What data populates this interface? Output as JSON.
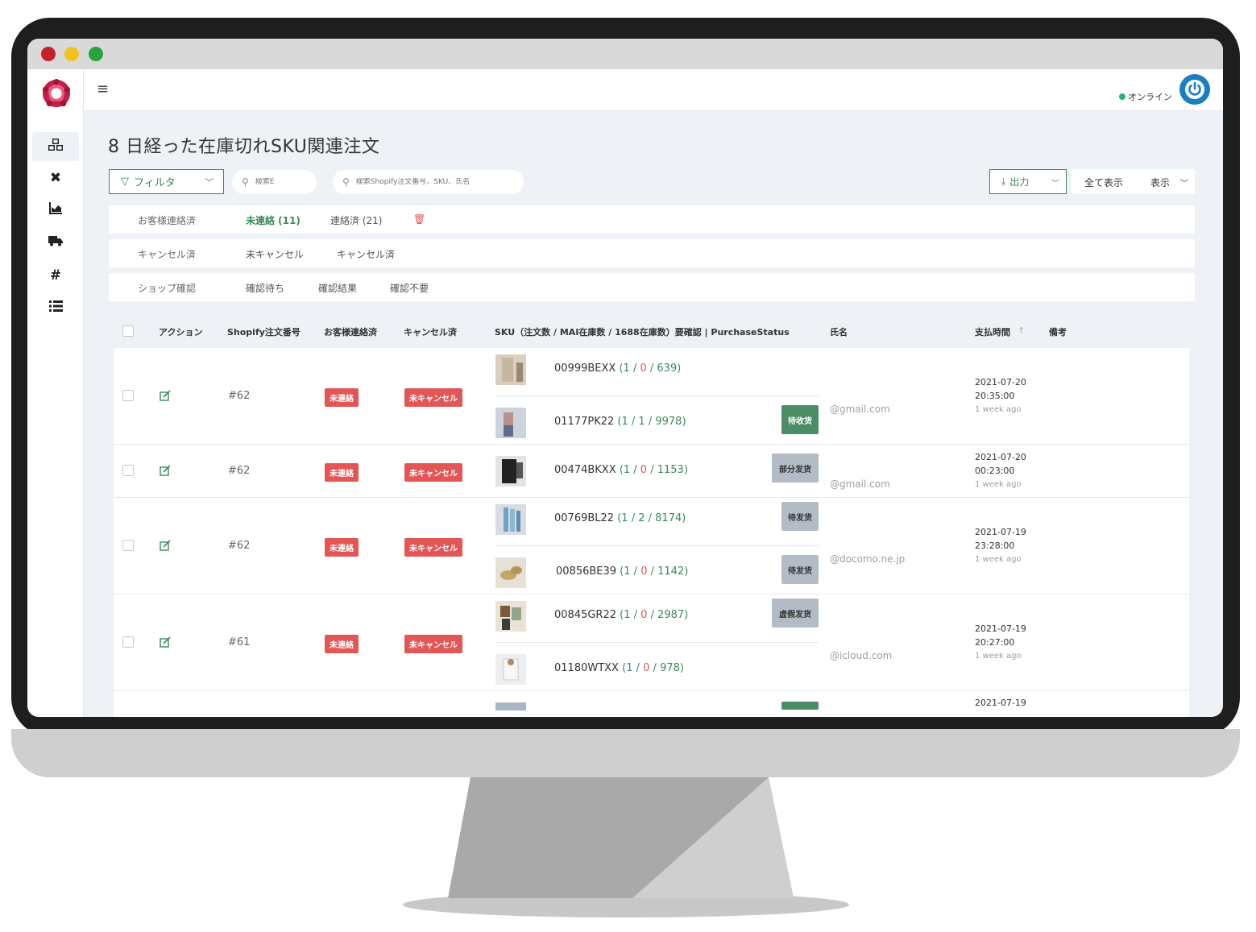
{
  "header": {
    "online_label": "オンライン"
  },
  "page": {
    "title": "8 日経った在庫切れSKU関連注文"
  },
  "toolbar": {
    "filter_label": "フィルタ",
    "search_small_placeholder": "検索E",
    "search_large_placeholder": "検索Shopify注文番号、SKU、氏名",
    "export_label": "出力",
    "show_all_label": "全て表示",
    "display_label": "表示"
  },
  "filters": {
    "contact": {
      "label": "お客様連絡済",
      "opt1": "未連絡 (11)",
      "opt2": "連絡済 (21)"
    },
    "cancel": {
      "label": "キャンセル済",
      "opt1": "未キャンセル",
      "opt2": "キャンセル済"
    },
    "shop": {
      "label": "ショップ確認",
      "opt1": "確認待ち",
      "opt2": "確認結果",
      "opt3": "確認不要"
    }
  },
  "table": {
    "headers": {
      "action": "アクション",
      "order_no": "Shopify注文番号",
      "contacted": "お客様連絡済",
      "cancelled": "キャンセル済",
      "sku": "SKU（注文数 / MAI在庫数 / 1688在庫数）要確認 | PurchaseStatus",
      "name": "氏名",
      "paid_time": "支払時間",
      "sort_icon": "arrow-up",
      "remarks": "備考"
    },
    "rows": [
      {
        "order": "#62",
        "contact": "未連絡",
        "cancel": "未キャンセル",
        "email": "@gmail.com",
        "date": "2021-07-20",
        "time": "20:35:00",
        "ago": "1 week ago",
        "skus": [
          {
            "code": "00999BEXX",
            "n1": "1",
            "n2": "0",
            "n3": "639",
            "status": ""
          },
          {
            "code": "01177PK22",
            "n1": "1",
            "n2": "1",
            "n3": "9978",
            "status": "待收货"
          }
        ]
      },
      {
        "order": "#62",
        "contact": "未連絡",
        "cancel": "未キャンセル",
        "email": "@gmail.com",
        "date": "2021-07-20",
        "time": "00:23:00",
        "ago": "1 week ago",
        "skus": [
          {
            "code": "00474BKXX",
            "n1": "1",
            "n2": "0",
            "n3": "1153",
            "status": "部分发货"
          }
        ]
      },
      {
        "order": "#62",
        "contact": "未連絡",
        "cancel": "未キャンセル",
        "email": "@docomo.ne.jp",
        "date": "2021-07-19",
        "time": "23:28:00",
        "ago": "1 week ago",
        "skus": [
          {
            "code": "00769BL22",
            "n1": "1",
            "n2": "2",
            "n3": "8174",
            "status": "待发货"
          },
          {
            "code": "00856BE39",
            "n1": "1",
            "n2": "0",
            "n3": "1142",
            "status": "待发货"
          }
        ]
      },
      {
        "order": "#61",
        "contact": "未連絡",
        "cancel": "未キャンセル",
        "email": "@icloud.com",
        "date": "2021-07-19",
        "time": "20:27:00",
        "ago": "1 week ago",
        "skus": [
          {
            "code": "00845GR22",
            "n1": "1",
            "n2": "0",
            "n3": "2987",
            "status": "虚假发货"
          },
          {
            "code": "01180WTXX",
            "n1": "1",
            "n2": "0",
            "n3": "978",
            "status": ""
          }
        ]
      },
      {
        "date": "2021-07-19"
      }
    ]
  },
  "colors": {
    "accent": "#3a8a5a",
    "danger": "#e25656",
    "status_green": "#4a8d66",
    "status_gray": "#b3bcc6",
    "power": "#1a7ec3"
  }
}
